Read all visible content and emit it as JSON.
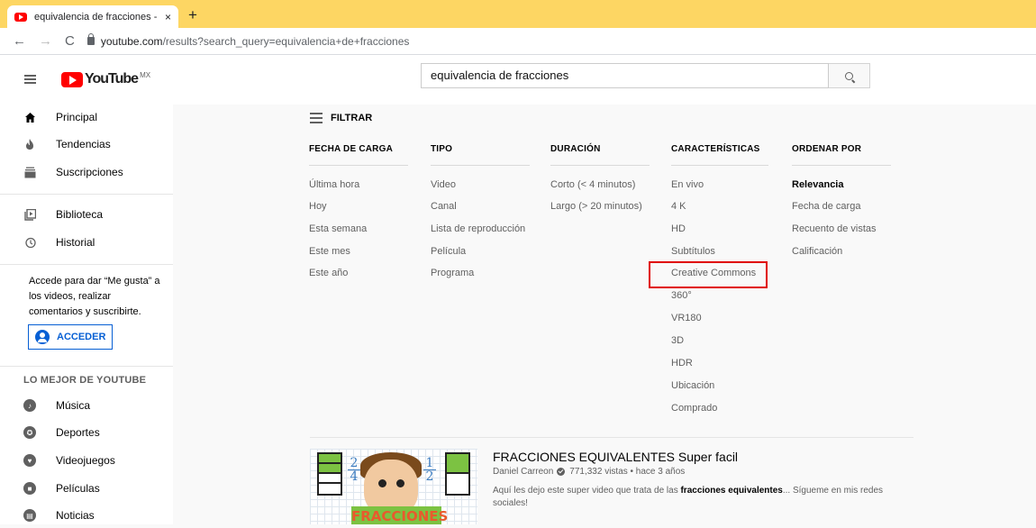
{
  "browser": {
    "tab_title": "equivalencia de fracciones - YouTube",
    "tab_close": "×",
    "new_tab": "+",
    "url_host": "youtube.com",
    "url_path": "/results?search_query=equivalencia+de+fracciones"
  },
  "masthead": {
    "logo_text": "YouTube",
    "logo_country": "MX",
    "search_value": "equivalencia de fracciones"
  },
  "sidebar": {
    "items": [
      {
        "label": "Principal",
        "icon": "home-icon"
      },
      {
        "label": "Tendencias",
        "icon": "flame-icon"
      },
      {
        "label": "Suscripciones",
        "icon": "subscriptions-icon"
      },
      {
        "label": "Biblioteca",
        "icon": "library-icon"
      },
      {
        "label": "Historial",
        "icon": "history-icon"
      }
    ],
    "signin_text": "Accede para dar “Me gusta” a los videos, realizar comentarios y suscribirte.",
    "signin_button": "ACCEDER",
    "best_title": "LO MEJOR DE YOUTUBE",
    "best_items": [
      {
        "label": "Música",
        "icon": "music-icon"
      },
      {
        "label": "Deportes",
        "icon": "sports-icon"
      },
      {
        "label": "Videojuegos",
        "icon": "gaming-icon"
      },
      {
        "label": "Películas",
        "icon": "movies-icon"
      },
      {
        "label": "Noticias",
        "icon": "news-icon"
      }
    ]
  },
  "filters": {
    "title": "FILTRAR",
    "columns": [
      {
        "header": "FECHA DE CARGA",
        "options": [
          "Última hora",
          "Hoy",
          "Esta semana",
          "Este mes",
          "Este año"
        ]
      },
      {
        "header": "TIPO",
        "options": [
          "Video",
          "Canal",
          "Lista de reproducción",
          "Película",
          "Programa"
        ]
      },
      {
        "header": "DURACIÓN",
        "options": [
          "Corto (< 4 minutos)",
          "Largo (> 20 minutos)"
        ]
      },
      {
        "header": "CARACTERÍSTICAS",
        "options": [
          "En vivo",
          "4 K",
          "HD",
          "Subtítulos",
          "Creative Commons",
          "360°",
          "VR180",
          "3D",
          "HDR",
          "Ubicación",
          "Comprado"
        ]
      },
      {
        "header": "ORDENAR POR",
        "options": [
          "Relevancia",
          "Fecha de carga",
          "Recuento de vistas",
          "Calificación"
        ],
        "selected": "Relevancia"
      }
    ]
  },
  "result": {
    "title": "FRACCIONES EQUIVALENTES Super facil",
    "channel": "Daniel Carreon",
    "meta": "771,332 vistas • hace 3 años",
    "desc_before": "Aquí les dejo este super video que trata de las ",
    "desc_bold": "fracciones equivalentes",
    "desc_after": "... Sígueme en mis redes sociales!",
    "thumb_text": "FRACCIONES",
    "thumb_fraction_left": {
      "num": "2",
      "den": "4"
    },
    "thumb_fraction_right": {
      "num": "1",
      "den": "2"
    }
  },
  "colors": {
    "accent_blue": "#065fd4",
    "youtube_red": "#ff0000",
    "highlight_red": "#e00000",
    "tabbar_yellow": "#fdd663"
  }
}
